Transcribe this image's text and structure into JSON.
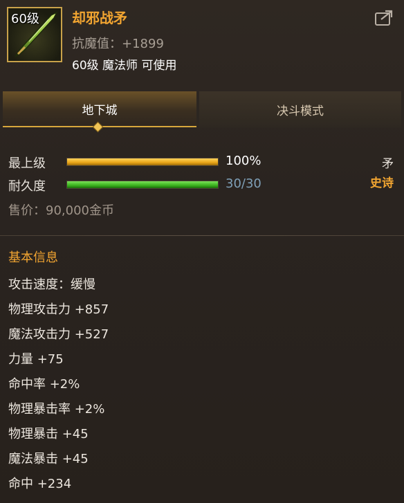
{
  "item": {
    "level_tag": "60级",
    "name": "却邪战矛",
    "stat_line": "抗魔值：+1899",
    "requirement": "60级 魔法师 可使用",
    "type": "矛",
    "rarity": "史诗"
  },
  "tabs": [
    {
      "label": "地下城",
      "active": true
    },
    {
      "label": "决斗模式",
      "active": false
    }
  ],
  "bars": {
    "level": {
      "label": "最上级",
      "value_text": "100%",
      "fill_fraction": 1.0,
      "color": "#e8a417"
    },
    "durability": {
      "label": "耐久度",
      "value_text": "30/30",
      "fill_fraction": 1.0,
      "color": "#39b21d"
    }
  },
  "price": "售价：90,000金币",
  "section_title": "基本信息",
  "attributes": [
    "攻击速度：缓慢",
    "物理攻击力 +857",
    "魔法攻击力 +527",
    "力量 +75",
    "命中率 +2%",
    "物理暴击率 +2%",
    "物理暴击 +45",
    "魔法暴击 +45",
    "命中 +234"
  ],
  "colors": {
    "accent": "#f2a531",
    "background": "#2a231d",
    "tab_active_border": "#d8a83c",
    "durability_value": "#7fa0b8"
  },
  "icons": {
    "item_icon": "green-spear-icon",
    "share": "share-icon",
    "tab_indicator": "diamond-indicator-icon"
  }
}
